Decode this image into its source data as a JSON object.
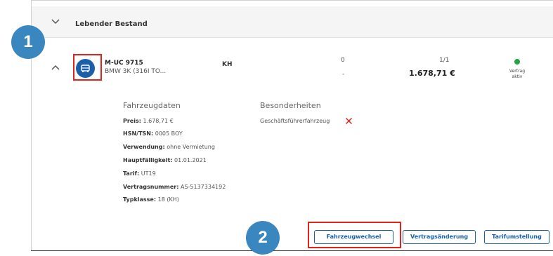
{
  "group": {
    "title": "Lebender Bestand"
  },
  "vehicle": {
    "plate": "M-UC 9715",
    "model": "BMW 3K (316I TO...",
    "sparte": "KH",
    "count_top": "0",
    "count_bottom": "-",
    "fraction": "1/1",
    "amount": "1.678,71 €",
    "status": {
      "line1": "Vertrag",
      "line2": "aktiv",
      "color": "#22a348"
    }
  },
  "details": {
    "section_title": "Fahrzeugdaten",
    "rows": [
      {
        "label": "Preis:",
        "value": "1.678,71 €"
      },
      {
        "label": "HSN/TSN:",
        "value": "0005 BOY"
      },
      {
        "label": "Verwendung:",
        "value": "ohne Vermietung"
      },
      {
        "label": "Hauptfälligkeit:",
        "value": "01.01.2021"
      },
      {
        "label": "Tarif:",
        "value": "UT19"
      },
      {
        "label": "Vertragsnummer:",
        "value": "AS-5137334192"
      },
      {
        "label": "Typklasse:",
        "value": "18 (KH)"
      }
    ]
  },
  "special": {
    "section_title": "Besonderheiten",
    "items": [
      {
        "label": "Geschäftsführerfahrzeug"
      }
    ]
  },
  "actions": {
    "vehicle_change": "Fahrzeugwechsel",
    "contract_change": "Vertragsänderung",
    "tariff_change": "Tarifumstellung"
  },
  "callouts": {
    "one": "1",
    "two": "2"
  },
  "colors": {
    "accent": "#1b5fa8",
    "highlight": "#e0241b",
    "badge": "#3a86bf",
    "remove": "#e0241b"
  },
  "icons": {
    "group_toggle": "chevron-down-icon",
    "row_toggle": "chevron-up-icon",
    "vehicle": "car-icon",
    "remove": "close-icon"
  }
}
